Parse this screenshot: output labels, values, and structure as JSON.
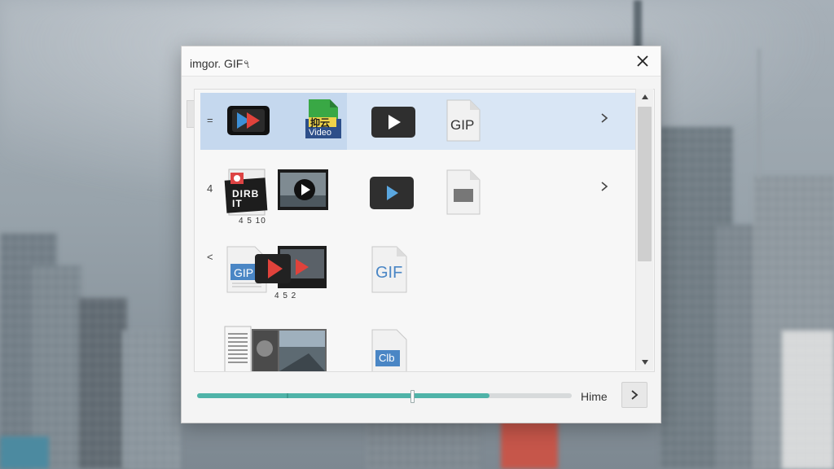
{
  "dialog": {
    "title": "imgor. GIF৭",
    "time_label": "Hime",
    "progress": 0.84,
    "progress_marker": 0.57,
    "progress_tick": 0.24
  },
  "rows": [
    {
      "label": "=",
      "selected": true,
      "items": [
        {
          "icon": "video-player-icon"
        },
        {
          "icon": "video-file-icon",
          "text_top": "抑云",
          "text_bottom": "Video"
        },
        {
          "icon": "play-button-icon"
        },
        {
          "icon": "gif-file-icon",
          "text": "GIP"
        }
      ]
    },
    {
      "label": "4",
      "selected": false,
      "items": [
        {
          "icon": "document-thumbnail-icon",
          "text": "DIRB IT",
          "caption": "4 5 10"
        },
        {
          "icon": "video-thumbnail-icon"
        },
        {
          "icon": "play-button-icon"
        },
        {
          "icon": "video-file-icon"
        }
      ]
    },
    {
      "label": "<",
      "selected": false,
      "items": [
        {
          "icon": "gif-document-icon",
          "text": "GIP",
          "caption": "4 5 2"
        },
        {
          "icon": "video-player-icon"
        },
        {
          "icon": "gif-file-icon",
          "text": "GIF"
        }
      ]
    },
    {
      "label": "",
      "selected": false,
      "items": [
        {
          "icon": "text-document-icon"
        },
        {
          "icon": "photo-thumbnail-icon"
        },
        {
          "icon": "gif-file-icon",
          "text": "Clb"
        }
      ]
    }
  ],
  "colors": {
    "selection": "#d9e6f5",
    "progress": "#4fb3a8",
    "play_red": "#e0423b",
    "play_blue": "#3d8fd6",
    "gif_blue": "#4a86c5"
  }
}
